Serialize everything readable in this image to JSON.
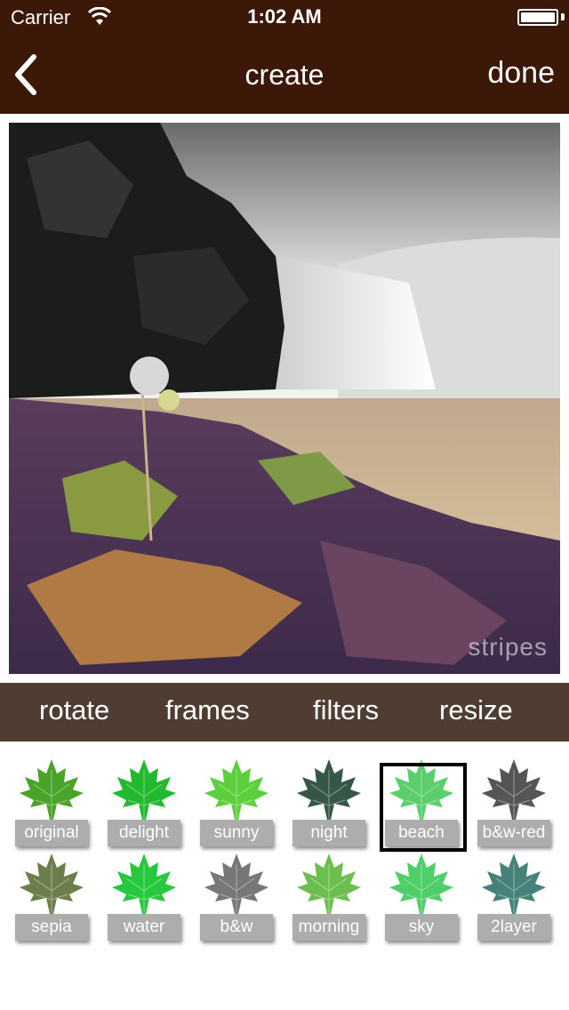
{
  "status_bar": {
    "carrier": "Carrier",
    "time": "1:02 AM"
  },
  "nav": {
    "title": "create",
    "done_label": "done",
    "back_icon": "chevron-left-icon"
  },
  "photo": {
    "watermark": "stripes"
  },
  "tabs": [
    {
      "label": "rotate"
    },
    {
      "label": "frames"
    },
    {
      "label": "filters"
    },
    {
      "label": "resize"
    }
  ],
  "filters": [
    {
      "label": "original",
      "color": "#4aa32a",
      "selected": false
    },
    {
      "label": "delight",
      "color": "#22b92e",
      "selected": false
    },
    {
      "label": "sunny",
      "color": "#5ccf3c",
      "selected": false
    },
    {
      "label": "night",
      "color": "#365747",
      "selected": false
    },
    {
      "label": "beach",
      "color": "#5bcf6c",
      "selected": true
    },
    {
      "label": "b&w-red",
      "color": "#555555",
      "selected": false
    },
    {
      "label": "sepia",
      "color": "#6b7e4c",
      "selected": false
    },
    {
      "label": "water",
      "color": "#27c83e",
      "selected": false
    },
    {
      "label": "b&w",
      "color": "#777777",
      "selected": false
    },
    {
      "label": "morning",
      "color": "#6cbf4f",
      "selected": false
    },
    {
      "label": "sky",
      "color": "#4fce6a",
      "selected": false
    },
    {
      "label": "2layer",
      "color": "#46817a",
      "selected": false
    }
  ],
  "colors": {
    "nav_bg": "#3b1807",
    "tabbar_bg": "#4f3d31"
  }
}
